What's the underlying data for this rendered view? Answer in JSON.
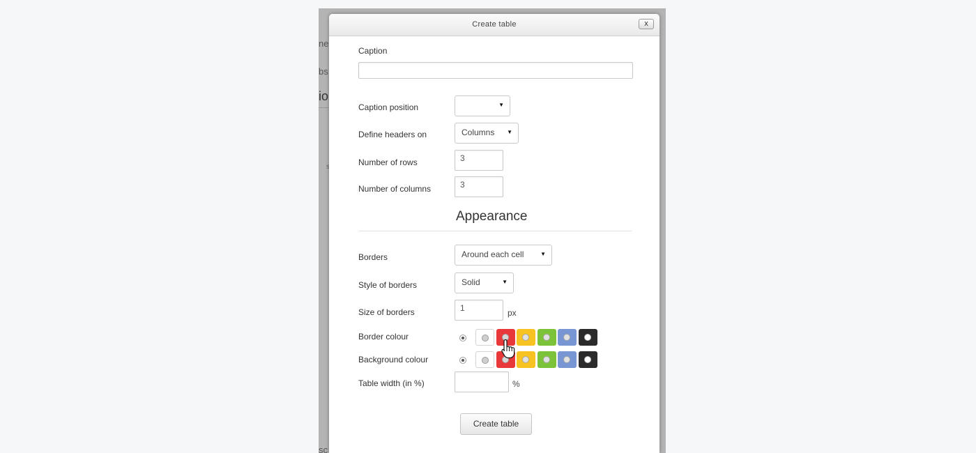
{
  "background_fragments": [
    "ne",
    "bs",
    "io",
    "s",
    "sc"
  ],
  "dialog": {
    "title": "Create table",
    "close_label": "x"
  },
  "form": {
    "caption": {
      "label": "Caption",
      "value": ""
    },
    "caption_position": {
      "label": "Caption position",
      "value": ""
    },
    "headers": {
      "label": "Define headers on",
      "value": "Columns"
    },
    "rows": {
      "label": "Number of rows",
      "value": "3"
    },
    "columns": {
      "label": "Number of columns",
      "value": "3"
    },
    "appearance_heading": "Appearance",
    "borders": {
      "label": "Borders",
      "value": "Around each cell"
    },
    "border_style": {
      "label": "Style of borders",
      "value": "Solid"
    },
    "border_size": {
      "label": "Size of borders",
      "value": "1",
      "unit": "px"
    },
    "border_colour": {
      "label": "Border colour"
    },
    "background_colour": {
      "label": "Background colour"
    },
    "table_width": {
      "label": "Table width (in %)",
      "value": "",
      "unit": "%"
    },
    "submit_label": "Create table"
  },
  "colour_swatches": [
    {
      "name": "white",
      "color": "#ffffff",
      "dot": "#cfcfcf"
    },
    {
      "name": "red",
      "color": "#e8383a",
      "dot": "#d8d8d8"
    },
    {
      "name": "yellow",
      "color": "#f6c323",
      "dot": "#e2e2e2"
    },
    {
      "name": "green",
      "color": "#7cc33a",
      "dot": "#e2e2e2"
    },
    {
      "name": "blue",
      "color": "#7895d4",
      "dot": "#e2e2e2"
    },
    {
      "name": "black",
      "color": "#2b2b2b",
      "dot": "#ffffff"
    }
  ]
}
